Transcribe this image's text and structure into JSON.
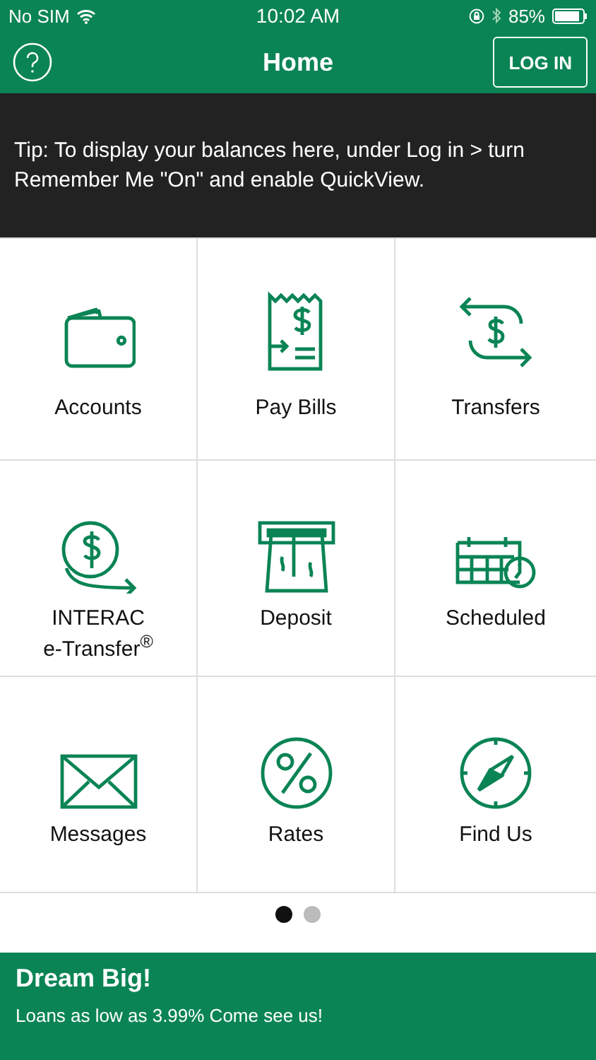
{
  "status_bar": {
    "carrier": "No SIM",
    "time": "10:02 AM",
    "battery": "85%"
  },
  "nav": {
    "title": "Home",
    "login": "LOG IN"
  },
  "tip": "Tip: To display your balances here, under Log in > turn Remember Me \"On\" and enable QuickView.",
  "tiles": [
    {
      "kind": "wallet",
      "label": "Accounts"
    },
    {
      "kind": "bill",
      "label": "Pay Bills"
    },
    {
      "kind": "transfer",
      "label": "Transfers"
    },
    {
      "kind": "etransfer",
      "label": "INTERAC\ne-Transfer$^{®}$"
    },
    {
      "kind": "deposit",
      "label": "Deposit"
    },
    {
      "kind": "calendar",
      "label": "Scheduled"
    },
    {
      "kind": "envelope",
      "label": "Messages"
    },
    {
      "kind": "percent",
      "label": "Rates"
    },
    {
      "kind": "compass",
      "label": "Find Us"
    }
  ],
  "pages": [
    {
      "selected": true
    },
    {
      "selected": false
    }
  ],
  "banner": {
    "title": "Dream Big!",
    "text": "Loans as low as 3.99% Come see us!"
  }
}
